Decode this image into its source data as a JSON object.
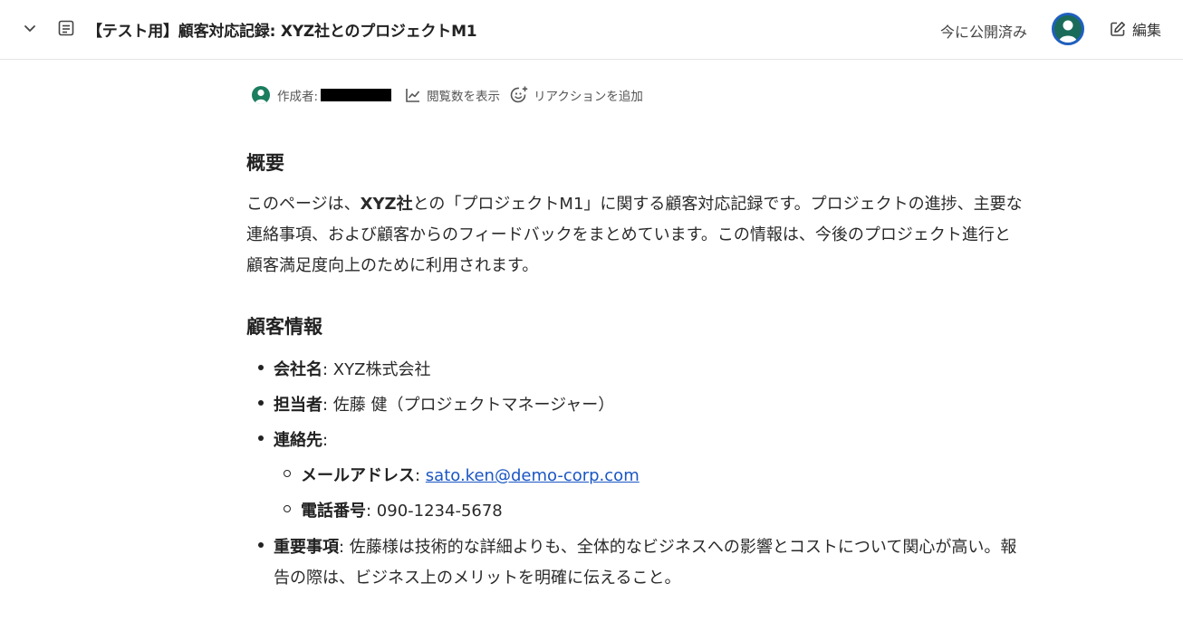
{
  "header": {
    "title": "【テスト用】顧客対応記録: XYZ社とのプロジェクトM1",
    "published": "今に公開済み",
    "edit_label": "編集"
  },
  "meta": {
    "author_label": "作成者:",
    "views_label": "閲覧数を表示",
    "reaction_label": "リアクションを追加"
  },
  "overview": {
    "heading": "概要",
    "text_pre": "このページは、",
    "text_bold": "XYZ社",
    "text_post": "との「プロジェクトM1」に関する顧客対応記録です。プロジェクトの進捗、主要な",
    "line2": "連絡事項、および顧客からのフィードバックをまとめています。この情報は、今後のプロジェクト進行と",
    "line3": "顧客満足度向上のために利用されます。"
  },
  "customer": {
    "heading": "顧客情報",
    "company_label": "会社名",
    "company_value": ": XYZ株式会社",
    "manager_label": "担当者",
    "manager_value": ": 佐藤 健（プロジェクトマネージャー）",
    "contact_label": "連絡先",
    "contact_colon": ":",
    "email_label": "メールアドレス",
    "email_colon": ": ",
    "email_value": "sato.ken@demo-corp.com",
    "phone_label": "電話番号",
    "phone_value": ": 090-1234-5678",
    "important_label": "重要事項",
    "important_line1": ": 佐藤様は技術的な詳細よりも、全体的なビジネスへの影響とコストについて関心が高い。報",
    "important_line2": "告の際は、ビジネス上のメリットを明確に伝えること。"
  },
  "colors": {
    "accent": "#1a56c4",
    "avatar": "#1a7d5e"
  }
}
